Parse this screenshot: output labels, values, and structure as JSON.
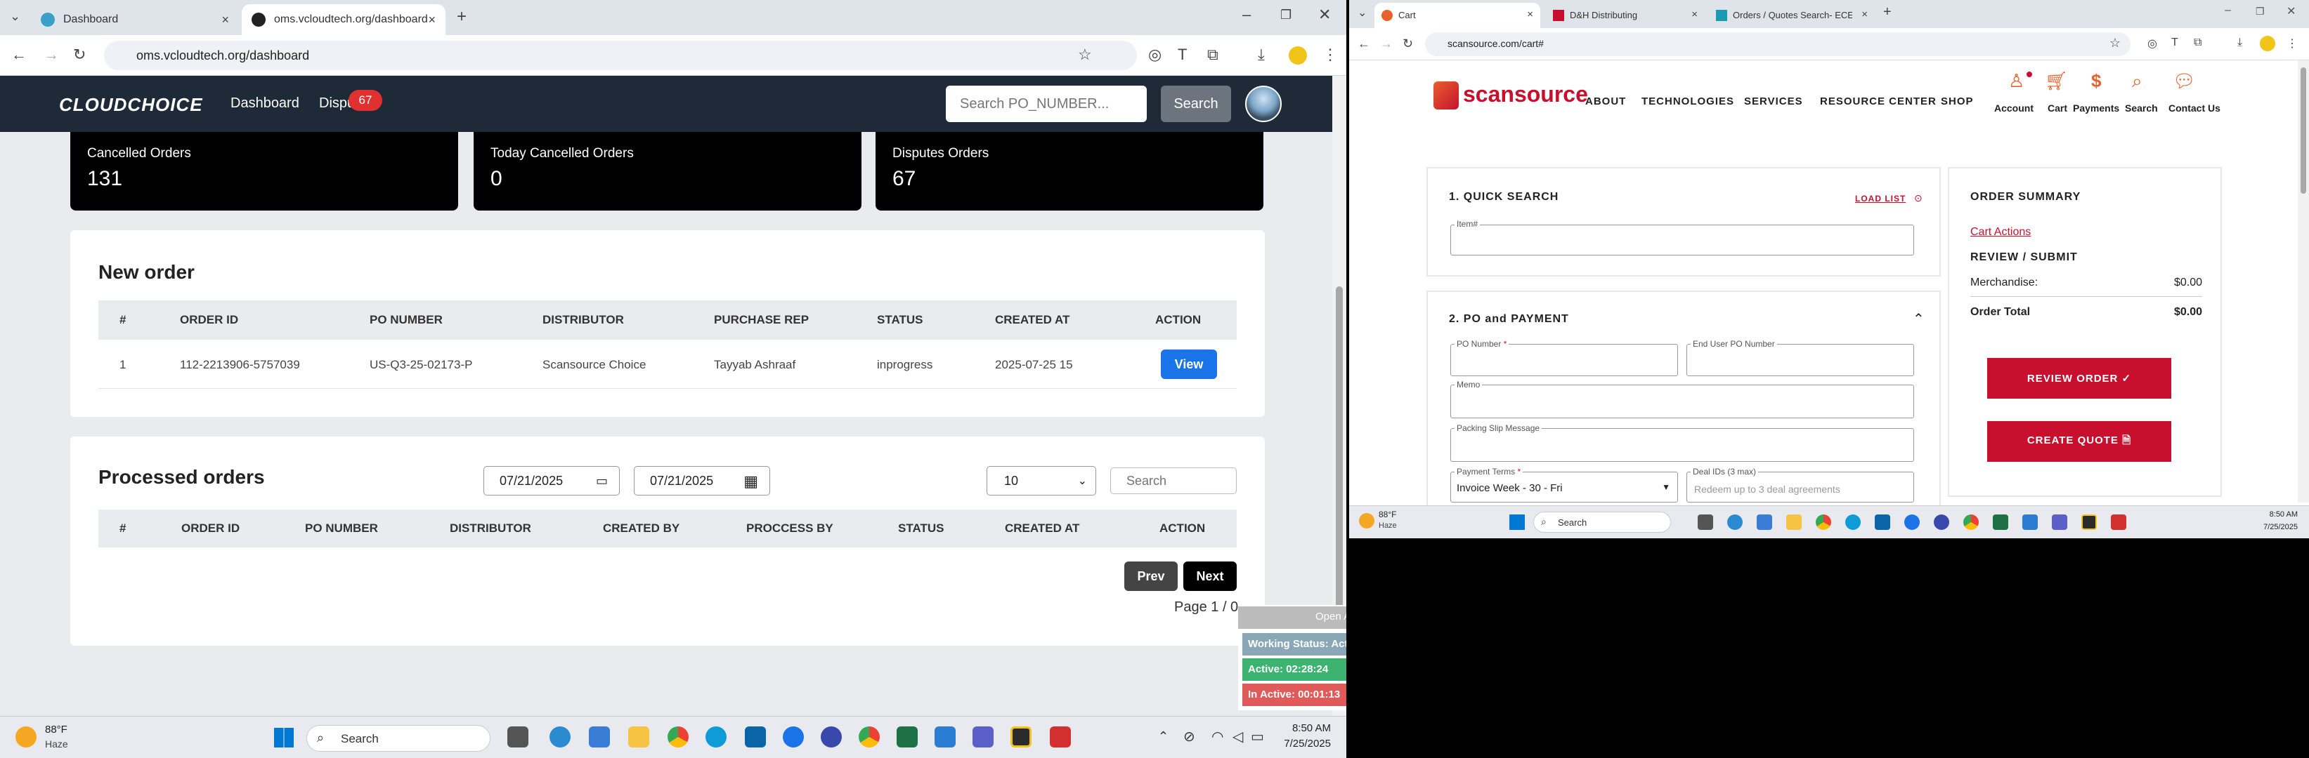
{
  "left_browser": {
    "tabs": [
      {
        "title": "Dashboard",
        "active": false
      },
      {
        "title": "oms.vcloudtech.org/dashboard",
        "active": true
      }
    ],
    "url": "oms.vcloudtech.org/dashboard"
  },
  "app": {
    "logo": "CLOUDCHOICE",
    "nav": [
      {
        "label": "Dashboard"
      },
      {
        "label": "Dispu"
      }
    ],
    "disputes_badge": "67",
    "search_placeholder": "Search PO_NUMBER...",
    "search_button": "Search"
  },
  "stat_cards": [
    {
      "label": "Cancelled Orders",
      "value": "131"
    },
    {
      "label": "Today Cancelled Orders",
      "value": "0"
    },
    {
      "label": "Disputes Orders",
      "value": "67"
    }
  ],
  "new_order": {
    "title": "New order",
    "headers": [
      "#",
      "ORDER ID",
      "PO NUMBER",
      "DISTRIBUTOR",
      "PURCHASE REP",
      "STATUS",
      "CREATED AT",
      "ACTION"
    ],
    "rows": [
      {
        "num": "1",
        "order_id": "112-2213906-5757039",
        "po_number": "US-Q3-25-02173-P",
        "distributor": "Scansource Choice",
        "rep": "Tayyab Ashraaf",
        "status": "inprogress",
        "created_at": "2025-07-25 15",
        "action": "View"
      }
    ]
  },
  "processed_orders": {
    "title": "Processed orders",
    "date_from": "07/21/2025",
    "date_to": "07/21/2025",
    "page_size": "10",
    "search_placeholder": "Search",
    "headers": [
      "#",
      "ORDER ID",
      "PO NUMBER",
      "DISTRIBUTOR",
      "CREATED BY",
      "PROCCESS BY",
      "STATUS",
      "CREATED AT",
      "ACTION"
    ],
    "prev": "Prev",
    "next": "Next",
    "page_info": "Page 1 / 0"
  },
  "status_widget": {
    "open": "Open A",
    "working": "Working Status: Act",
    "active": "Active: 02:28:24",
    "inactive": "In Active: 00:01:13"
  },
  "taskbar_left": {
    "weather_temp": "88°F",
    "weather_desc": "Haze",
    "search": "Search",
    "time": "8:50 AM",
    "date": "7/25/2025"
  },
  "right_browser": {
    "tabs": [
      {
        "title": "Cart",
        "active": true
      },
      {
        "title": "D&H Distributing",
        "active": false
      },
      {
        "title": "Orders / Quotes Search- ECExp",
        "active": false
      }
    ],
    "url": "scansource.com/cart#"
  },
  "scansource": {
    "logo": "scansource",
    "nav": [
      "ABOUT",
      "TECHNOLOGIES",
      "SERVICES",
      "RESOURCE CENTER",
      "SHOP"
    ],
    "icons": [
      {
        "label": "Account",
        "icon": "user-icon"
      },
      {
        "label": "Cart",
        "icon": "cart-icon"
      },
      {
        "label": "Payments",
        "icon": "dollar-icon"
      },
      {
        "label": "Search",
        "icon": "search-icon"
      },
      {
        "label": "Contact Us",
        "icon": "chat-icon"
      }
    ],
    "quick_search": {
      "title": "1. QUICK SEARCH",
      "load_list": "LOAD LIST",
      "item_label": "Item#"
    },
    "po_payment": {
      "title": "2. PO and PAYMENT",
      "po_number": "PO Number",
      "end_user_po": "End User PO Number",
      "memo": "Memo",
      "packing_slip": "Packing Slip Message",
      "payment_terms_label": "Payment Terms",
      "payment_terms_value": "Invoice Week - 30 - Fri",
      "deal_ids_label": "Deal IDs (3 max)",
      "deal_ids_placeholder": "Redeem up to 3 deal agreements"
    },
    "summary": {
      "title": "ORDER SUMMARY",
      "cart_actions": "Cart Actions",
      "review_title": "REVIEW / SUBMIT",
      "merchandise_label": "Merchandise:",
      "merchandise_value": "$0.00",
      "total_label": "Order Total",
      "total_value": "$0.00",
      "review_button": "REVIEW ORDER ✓",
      "quote_button": "CREATE QUOTE 🗎"
    }
  },
  "taskbar_right": {
    "weather_temp": "88°F",
    "weather_desc": "Haze",
    "search": "Search",
    "time": "8:50 AM",
    "date": "7/25/2025"
  }
}
